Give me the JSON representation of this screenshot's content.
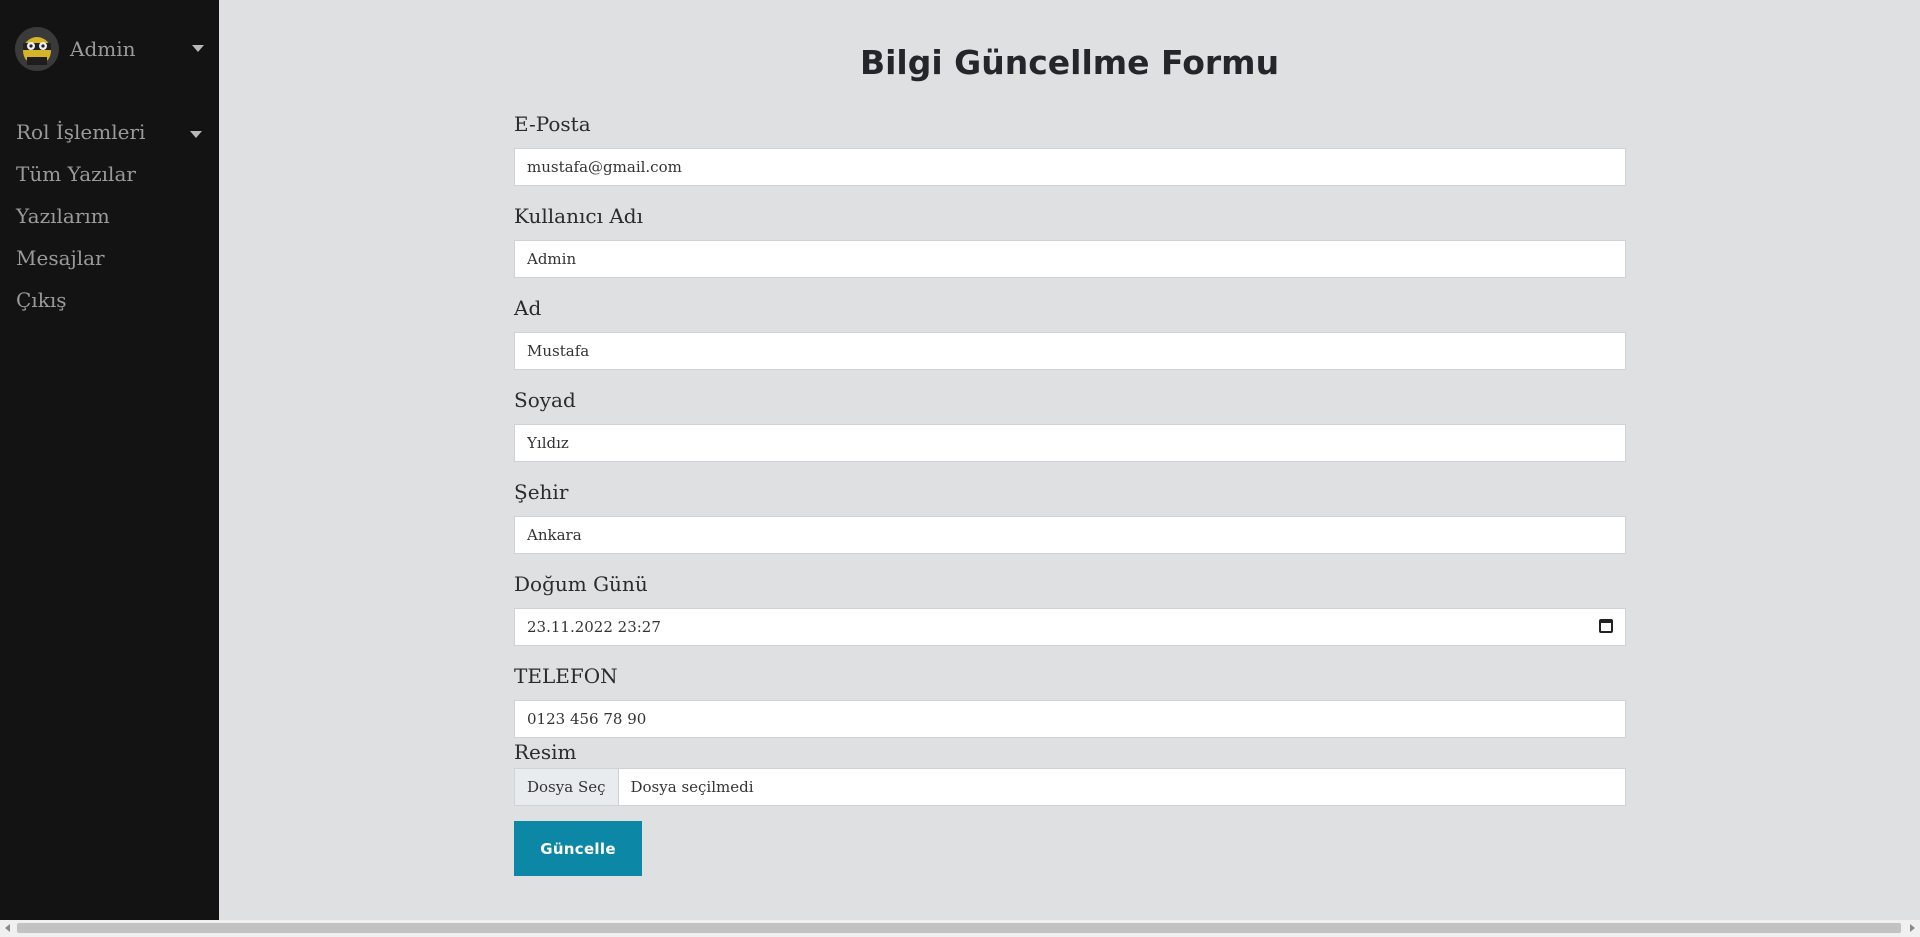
{
  "sidebar": {
    "user_name": "Admin",
    "menu": [
      {
        "label": "Rol İşlemleri",
        "has_submenu": true
      },
      {
        "label": "Tüm Yazılar"
      },
      {
        "label": "Yazılarım"
      },
      {
        "label": "Mesajlar"
      },
      {
        "label": "Çıkış"
      }
    ]
  },
  "page": {
    "title": "Bilgi Güncellme Formu"
  },
  "form": {
    "email": {
      "label": "E-Posta",
      "value": "mustafa@gmail.com"
    },
    "username": {
      "label": "Kullanıcı Adı",
      "value": "Admin"
    },
    "first_name": {
      "label": "Ad",
      "value": "Mustafa"
    },
    "last_name": {
      "label": "Soyad",
      "value": "Yıldız"
    },
    "city": {
      "label": "Şehir",
      "value": "Ankara"
    },
    "birthday": {
      "label": "Doğum Günü",
      "value": "23.11.2022 23:27"
    },
    "phone": {
      "label": "TELEFON",
      "value": "0123 456 78 90"
    },
    "image": {
      "label": "Resim",
      "button_label": "Dosya Seç",
      "status": "Dosya seçilmedi"
    },
    "submit_label": "Güncelle"
  },
  "colors": {
    "sidebar_bg": "#131313",
    "page_bg": "#dfe0e2",
    "button_bg": "#0d87a6"
  }
}
